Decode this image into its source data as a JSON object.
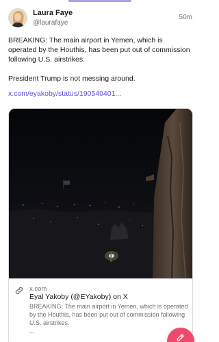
{
  "post": {
    "author_name": "Laura Faye",
    "author_handle": "@laurafaye",
    "timestamp": "50m",
    "text_paragraph_1": "BREAKING: The main airport in Yemen, which is operated by the Houthis, has been put out of commission following U.S. airstrikes.",
    "text_paragraph_2": "President Trump is not messing around.",
    "link_text": "x.com/eyakoby/status/190540401..."
  },
  "embed": {
    "domain": "x.com",
    "title": "Eyal Yakoby (@EYakoby) on X",
    "description": "BREAKING: The main airport in Yemen, which is operated by the Houthis, has been put out of commission following U.S. airstrikes.",
    "ellipsis": "..."
  },
  "icons": {
    "link": "link-icon",
    "compose": "pencil-icon",
    "avatar": "avatar"
  },
  "colors": {
    "accent": "#5b4fd9",
    "fab": "#f0496e",
    "indicator": "#a8a2e8"
  }
}
